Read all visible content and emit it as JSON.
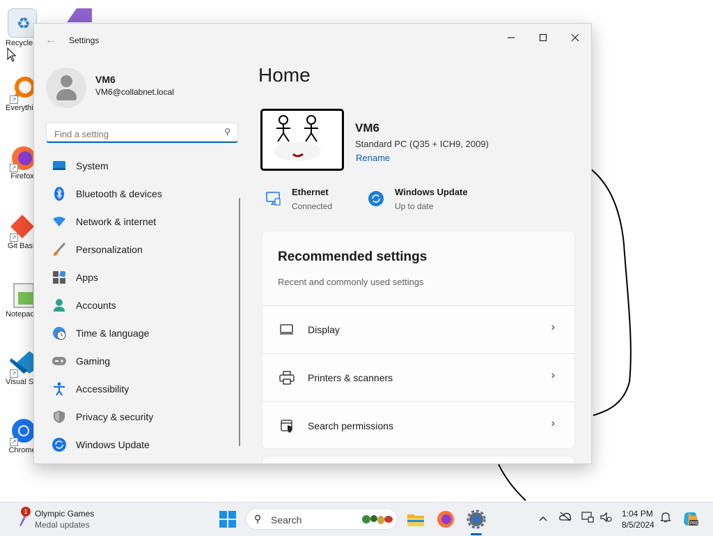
{
  "desktop": {
    "icons": [
      {
        "label": "Recycle Bin"
      },
      {
        "label": "Everything"
      },
      {
        "label": "Firefox"
      },
      {
        "label": "Git Bash"
      },
      {
        "label": "Notepad++"
      },
      {
        "label": "Visual Studio Code"
      },
      {
        "label": "Chrome"
      }
    ]
  },
  "window": {
    "title": "Settings",
    "controls": {
      "minimize": "—",
      "maximize": "☐",
      "close": "✕"
    }
  },
  "sidebar": {
    "user_name": "VM6",
    "user_email": "VM6@collabnet.local",
    "search_placeholder": "Find a setting",
    "items": [
      {
        "label": "System",
        "icon": "system-icon"
      },
      {
        "label": "Bluetooth & devices",
        "icon": "bluetooth-icon"
      },
      {
        "label": "Network & internet",
        "icon": "wifi-icon"
      },
      {
        "label": "Personalization",
        "icon": "brush-icon"
      },
      {
        "label": "Apps",
        "icon": "apps-icon"
      },
      {
        "label": "Accounts",
        "icon": "person-icon"
      },
      {
        "label": "Time & language",
        "icon": "globe-clock-icon"
      },
      {
        "label": "Gaming",
        "icon": "gamepad-icon"
      },
      {
        "label": "Accessibility",
        "icon": "accessibility-icon"
      },
      {
        "label": "Privacy & security",
        "icon": "shield-icon"
      },
      {
        "label": "Windows Update",
        "icon": "update-icon"
      }
    ]
  },
  "main": {
    "title": "Home",
    "device": {
      "name": "VM6",
      "description": "Standard PC (Q35 + ICH9, 2009)",
      "rename_label": "Rename"
    },
    "status": [
      {
        "title": "Ethernet",
        "subtitle": "Connected",
        "icon": "ethernet-icon"
      },
      {
        "title": "Windows Update",
        "subtitle": "Up to date",
        "icon": "update-icon"
      }
    ],
    "recommended": {
      "title": "Recommended settings",
      "subtitle": "Recent and commonly used settings",
      "rows": [
        {
          "label": "Display",
          "icon": "display-icon"
        },
        {
          "label": "Printers & scanners",
          "icon": "printer-icon"
        },
        {
          "label": "Search permissions",
          "icon": "search-permissions-icon"
        }
      ]
    }
  },
  "taskbar": {
    "widget": {
      "title": "Olympic Games",
      "subtitle": "Medal updates",
      "badge": "1"
    },
    "search_label": "Search",
    "clock": {
      "time": "1:04 PM",
      "date": "8/5/2024"
    },
    "apps": [
      "windows-start-icon",
      "file-explorer-icon",
      "firefox-icon",
      "settings-gear-icon"
    ],
    "accent": "#005fb8"
  }
}
